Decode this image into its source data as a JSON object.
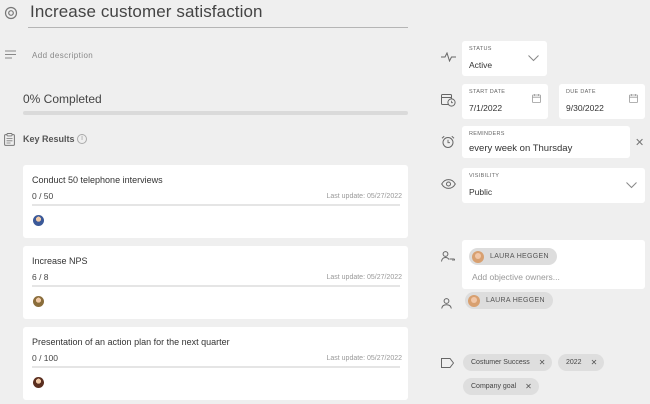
{
  "objective": {
    "title": "Increase customer satisfaction",
    "description_placeholder": "Add description"
  },
  "progress": {
    "label": "0% Completed",
    "percent": 0
  },
  "key_results": {
    "title": "Key Results",
    "items": [
      {
        "name": "Conduct 50 telephone interviews",
        "progress": "0 / 50",
        "fraction": 0.0,
        "updated": "Last update: 05/27/2022",
        "avatar_color": "#3b5998"
      },
      {
        "name": "Increase NPS",
        "progress": "6 / 8",
        "fraction": 0.0,
        "updated": "Last update: 05/27/2022",
        "avatar_color": "#8a6d3b"
      },
      {
        "name": "Presentation of an action plan for the next quarter",
        "progress": "0 / 100",
        "fraction": 0.0,
        "updated": "Last update: 05/27/2022",
        "avatar_color": "#5a2e1f"
      }
    ]
  },
  "sidebar": {
    "status": {
      "label": "STATUS",
      "value": "Active"
    },
    "start_date": {
      "label": "START DATE",
      "value": "7/1/2022"
    },
    "due_date": {
      "label": "DUE DATE",
      "value": "9/30/2022"
    },
    "reminders": {
      "label": "REMINDERS",
      "value": "every week on Thursday"
    },
    "visibility": {
      "label": "VISIBILITY",
      "value": "Public"
    },
    "owners": {
      "owner": "LAURA HEGGEN",
      "placeholder": "Add objective owners..."
    },
    "assignee": {
      "name": "LAURA HEGGEN"
    },
    "tags": [
      {
        "label": "Costumer Success"
      },
      {
        "label": "2022"
      },
      {
        "label": "Company goal"
      }
    ]
  },
  "colors": {
    "accent": "#4a90d9",
    "background": "#efefef"
  }
}
